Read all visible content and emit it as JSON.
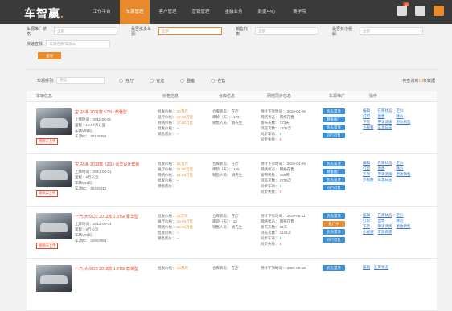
{
  "app": {
    "logo": "车智赢",
    "nav": [
      "工作平台",
      "车源管理",
      "客户管理",
      "营销管理",
      "金融业务",
      "数据中心",
      "商学院"
    ],
    "message_badge": "10"
  },
  "filters": {
    "car_source_status_label": "车源推广状态:",
    "car_source_status_value": "全部",
    "multi_store_label": "是否批发车源:",
    "multi_store_value": "全部",
    "salesperson_label": "销售代表:",
    "salesperson_value": "全部",
    "mini_program_label": "是否有小视频:",
    "mini_program_value": "全部",
    "quick_search_label": "快速查找:",
    "quick_search_placeholder": "车源名称/车源ID",
    "query_button": "查询"
  },
  "sortbar": {
    "label": "车源排列:",
    "select_value": "默认",
    "radios": [
      "在厅",
      "在途",
      "整备",
      "在售"
    ],
    "total_prefix": "共查询到",
    "total_count": "10",
    "total_suffix": "条数据"
  },
  "table": {
    "headers": [
      "车辆信息",
      "价格信息",
      "仓库信息",
      "网络同步信息",
      "车源推广",
      "操作"
    ],
    "rows": [
      {
        "title": "宝马5系 2011款 523Li 典雅型",
        "info": [
          "上牌时间：2011-06-01",
          "里程：10.67万公里",
          "车辆VIN码：",
          "车源ID：  30155385"
        ],
        "tag": "视频未上传",
        "price": [
          "批发价格：  20万元",
          "展厅价格：  17.60万元",
          "网络价格：  17.60万元",
          "批发价格：  --",
          "销售底价：  --"
        ],
        "warehouse": [
          "仓库状态：  在厅",
          "库龄（天）：  173",
          "销售人员：  姚先生"
        ],
        "sync": [
          "预计下架时间：  2019-04-29",
          "网络状态：  网络在售",
          "发布天数：  173天",
          "浏览次数：  1437次",
          "同步车商：  0",
          "同步失败：  0"
        ],
        "promo": [
          "优先置顶",
          "精准推广",
          "优先置顶",
          "同行可售"
        ],
        "ops": [
          "编辑",
          "在库状态",
          "定价",
          "打印",
          "出售",
          "降价",
          "下架",
          "申请调拨",
          "更改销售",
          "小视频",
          "车源日志"
        ]
      },
      {
        "title": "宝马5系 2013款 525Li 豪华设计套装",
        "info": [
          "上牌时间：2013-06-01",
          "里程：8万公里",
          "车辆VIN码：",
          "车源ID：  30425312"
        ],
        "tag": "视频未上传",
        "price": [
          "批发价格：  22万元",
          "展厅价格：  21.80万元",
          "网络价格：  21.80万元",
          "批发价格：  --",
          "销售底价：  --"
        ],
        "warehouse": [
          "仓库状态：  在厅",
          "库龄（天）：  156",
          "销售人员：  姚先生"
        ],
        "sync": [
          "预计下架时间：  2019-04-29",
          "网络状态：  网络在售",
          "发布天数：  156天",
          "浏览次数：  2706次",
          "同步车商：  0",
          "同步失败：  0"
        ],
        "promo": [
          "优先置顶",
          "精准推广",
          "优先置顶",
          "同行可售"
        ],
        "ops": [
          "编辑",
          "在库状态",
          "定价",
          "打印",
          "出售",
          "降价",
          "下架",
          "申请调拨",
          "更改销售",
          "小视频",
          "车源日志"
        ]
      },
      {
        "title": "一汽-大众CC 2012款 1.8TSI 豪华型",
        "info": [
          "上牌时间：2012-06-01",
          "里程：9万公里",
          "车辆VIN码：",
          "车源ID：  32903983"
        ],
        "tag": "视频未上传",
        "price": [
          "批发价格：  11万元",
          "展厅价格：  10.90万元",
          "网络价格：  10.80万元",
          "批发价格：  --",
          "销售底价：  --"
        ],
        "warehouse": [
          "仓库状态：  在厅",
          "库龄（天）：  22",
          "销售人员：  姚先生"
        ],
        "sync": [
          "预计下架时间：  2019-05-11",
          "网络状态：  网络在售",
          "发布天数：  22天",
          "浏览次数：  1142次",
          "同步车商：  0",
          "同步失败：  0"
        ],
        "promo": [
          "优先置顶",
          "推广中",
          "优先置顶",
          "同行可售"
        ],
        "ops": [
          "编辑",
          "在库状态",
          "定价",
          "打印",
          "出售",
          "降价",
          "下架",
          "申请调拨",
          "更改销售",
          "小视频",
          "车源日志"
        ]
      },
      {
        "title": "一汽-大众CC 2013款 1.8TSI 尊荣型",
        "info": [],
        "tag": "",
        "price": [
          "批发价格：  13万元"
        ],
        "warehouse": [
          "仓库状态：  在厅"
        ],
        "sync": [
          "预计下架时间：  2019-05-13"
        ],
        "promo": [
          "优先置顶"
        ],
        "ops": [
          "编辑",
          "在库状态"
        ]
      }
    ]
  },
  "colors": {
    "accent": "#e98a2d",
    "link": "#3b79c4",
    "alert": "#e3462e",
    "button_blue": "#3b8fd6"
  }
}
